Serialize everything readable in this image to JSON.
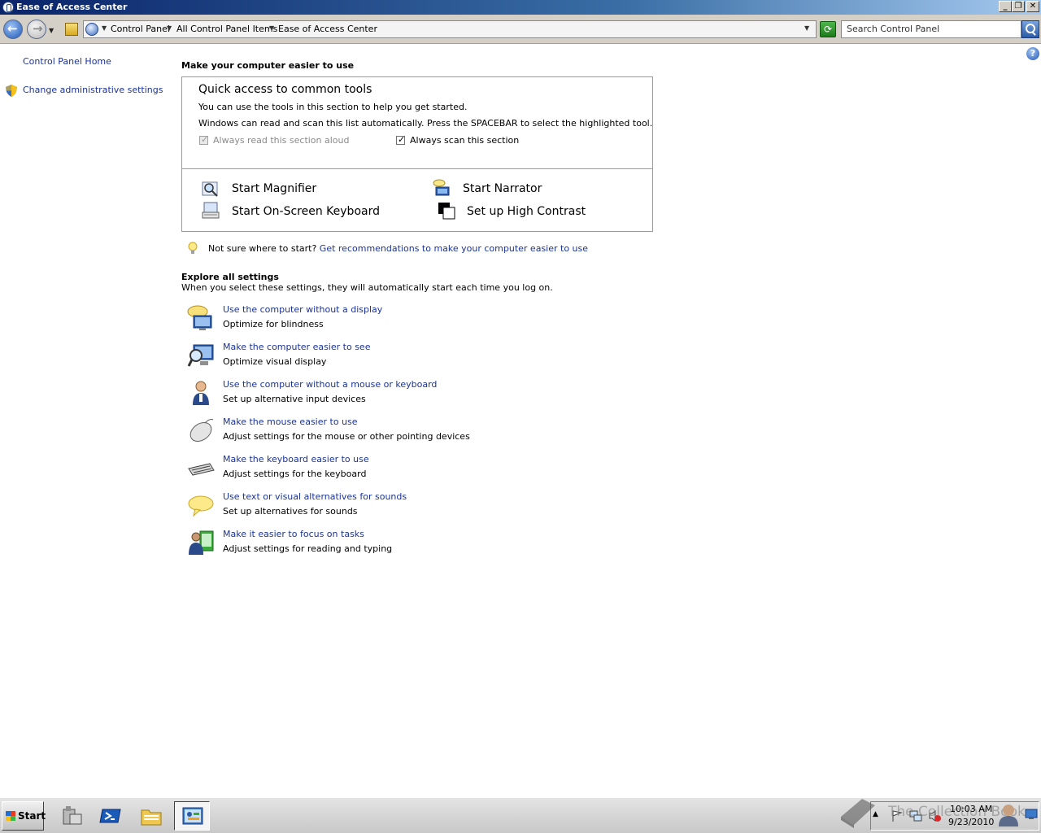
{
  "window": {
    "title": "Ease of Access Center"
  },
  "address": {
    "breadcrumbs": [
      "Control Panel",
      "All Control Panel Items",
      "Ease of Access Center"
    ],
    "search_placeholder": "Search Control Panel"
  },
  "sidebar": {
    "home_link": "Control Panel Home",
    "admin_link": "Change administrative settings"
  },
  "main": {
    "heading": "Make your computer easier to use",
    "quick_access": {
      "title": "Quick access to common tools",
      "line1": "You can use the tools in this section to help you get started.",
      "line2": "Windows can read and scan this list automatically.  Press the SPACEBAR to select the highlighted tool.",
      "read_aloud_label": "Always read this section aloud",
      "read_aloud_checked": true,
      "scan_label": "Always scan this section",
      "scan_checked": true,
      "tools": [
        "Start Magnifier",
        "Start Narrator",
        "Start On-Screen Keyboard",
        "Set up High Contrast"
      ]
    },
    "tip": {
      "prefix": "Not sure where to start?",
      "link": "Get recommendations to make your computer easier to use"
    },
    "explore": {
      "title": "Explore all settings",
      "subtitle": "When you select these settings, they will automatically start each time you log on.",
      "items": [
        {
          "link": "Use the computer without a display",
          "desc": "Optimize for blindness",
          "icon": "monitor-speech-icon"
        },
        {
          "link": "Make the computer easier to see",
          "desc": "Optimize visual display",
          "icon": "monitor-magnifier-icon"
        },
        {
          "link": "Use the computer without a mouse or keyboard",
          "desc": "Set up alternative input devices",
          "icon": "person-icon"
        },
        {
          "link": "Make the mouse easier to use",
          "desc": "Adjust settings for the mouse or other pointing devices",
          "icon": "mouse-icon"
        },
        {
          "link": "Make the keyboard easier to use",
          "desc": "Adjust settings for the keyboard",
          "icon": "keyboard-icon"
        },
        {
          "link": "Use text or visual alternatives for sounds",
          "desc": "Set up alternatives for sounds",
          "icon": "speech-bubble-icon"
        },
        {
          "link": "Make it easier to focus on tasks",
          "desc": "Adjust settings for reading and typing",
          "icon": "person-document-icon"
        }
      ]
    }
  },
  "taskbar": {
    "start_label": "Start",
    "clock_time": "10:03 AM",
    "clock_date": "9/23/2010",
    "watermark": "The Collection Book"
  }
}
